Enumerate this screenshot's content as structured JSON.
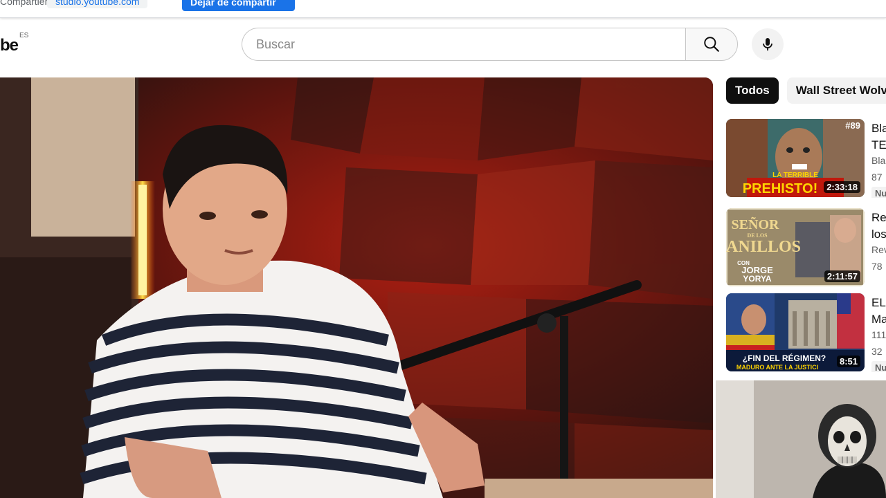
{
  "screen_share": {
    "sharing_text": "Compartiendo ventana con",
    "url_chip": "studio.youtube.com",
    "stop_button": "Dejar de compartir"
  },
  "header": {
    "logo_text": "YouTube",
    "logo_visible": "be",
    "country_code": "ES",
    "search_placeholder": "Buscar"
  },
  "chips": [
    {
      "label": "Todos",
      "active": true
    },
    {
      "label": "Wall Street Wolverine",
      "active": false
    }
  ],
  "recommendations": [
    {
      "title_line1": "Bla",
      "title_line2": "TE",
      "channel": "Bla",
      "views": "87",
      "badge": "Nu",
      "duration": "2:33:18",
      "thumb_text": "LA TERRIBLE PREHISTO...",
      "thumb_tag": "#89"
    },
    {
      "title_line1": "Re",
      "title_line2": "los",
      "channel": "Rev",
      "views": "78",
      "badge": "",
      "duration": "2:11:57",
      "thumb_text": "SEÑOR DE LOS ANILLOS",
      "thumb_sub": "CON JORGE YORYA"
    },
    {
      "title_line1": "EL",
      "title_line2": "Ma",
      "channel": "111",
      "views": "32",
      "badge": "Nu",
      "duration": "8:51",
      "thumb_text": "¿FIN DEL RÉGIMEN?",
      "thumb_sub": "MADURO ANTE LA JUSTICIA"
    }
  ],
  "colors": {
    "accent_blue": "#1a73e8",
    "text_primary": "#0f0f0f",
    "text_secondary": "#606060",
    "chip_active_bg": "#0f0f0f",
    "chip_inactive_bg": "#f2f2f2"
  }
}
